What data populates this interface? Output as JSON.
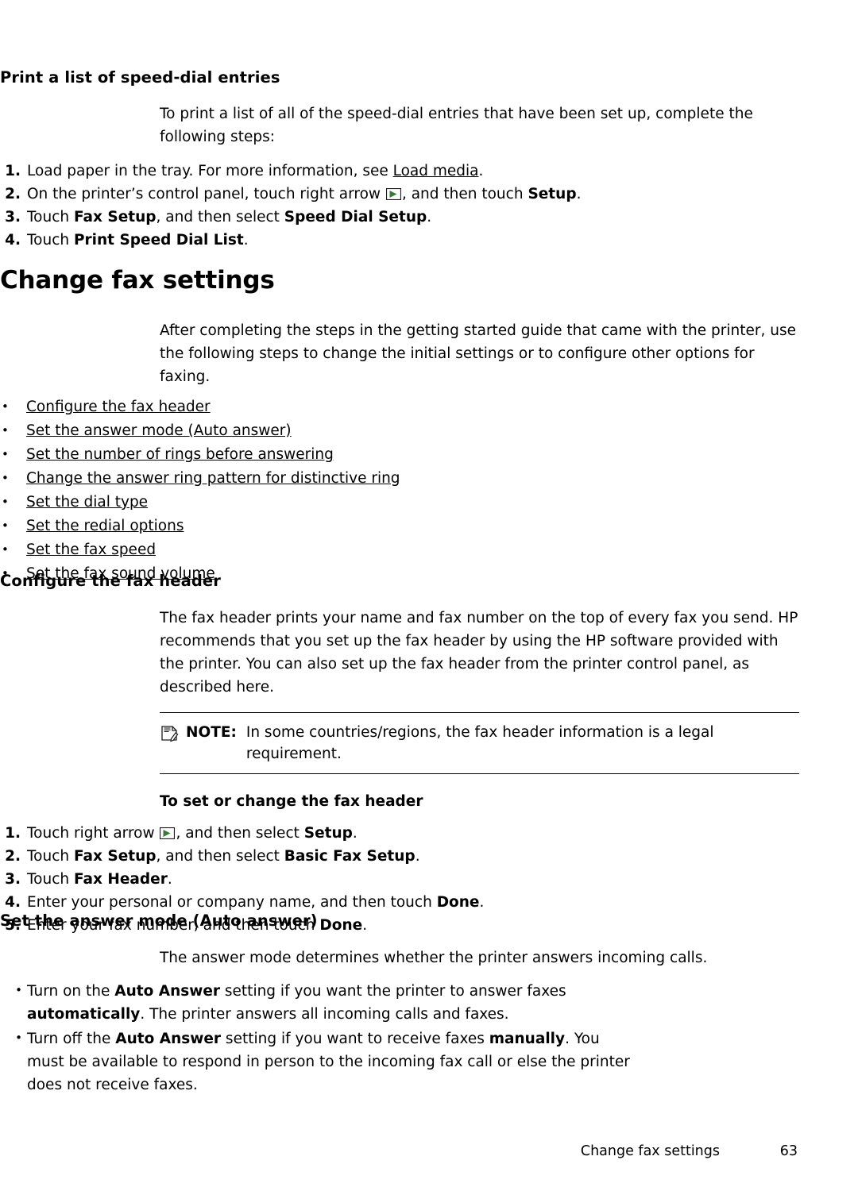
{
  "doc": {
    "section1": {
      "heading": "Print a list of speed-dial entries",
      "intro": "To print a list of all of the speed-dial entries that have been set up, complete the following steps:",
      "steps": [
        {
          "num": "1.",
          "pre": "Load paper in the tray. For more information, see ",
          "link": "Load media",
          "post": "."
        },
        {
          "num": "2.",
          "pre": "On the printer’s control panel, touch right arrow ",
          "icon": "right-arrow-icon",
          "mid": ", and then touch ",
          "bold": "Setup",
          "post": "."
        },
        {
          "num": "3.",
          "pre": "Touch ",
          "bold": "Fax Setup",
          "mid": ", and then select ",
          "bold2": "Speed Dial Setup",
          "post": "."
        },
        {
          "num": "4.",
          "pre": "Touch ",
          "bold": "Print Speed Dial List",
          "post": "."
        }
      ]
    },
    "section2": {
      "heading": "Change fax settings",
      "intro": "After completing the steps in the getting started guide that came with the printer, use the following steps to change the initial settings or to configure other options for faxing.",
      "links": [
        "Configure the fax header",
        "Set the answer mode (Auto answer)",
        "Set the number of rings before answering",
        "Change the answer ring pattern for distinctive ring",
        "Set the dial type",
        "Set the redial options",
        "Set the fax speed",
        "Set the fax sound volume"
      ]
    },
    "section3": {
      "heading": "Configure the fax header",
      "paragraph": "The fax header prints your name and fax number on the top of every fax you send. HP recommends that you set up the fax header by using the HP software provided with the printer. You can also set up the fax header from the printer control panel, as described here.",
      "note": {
        "label": "NOTE:",
        "text": "In some countries/regions, the fax header information is a legal requirement.",
        "icon": "note-icon"
      },
      "procedure_title": "To set or change the fax header",
      "steps": [
        {
          "num": "1.",
          "pre": "Touch right arrow ",
          "icon": "right-arrow-icon",
          "mid": ", and then select ",
          "bold": "Setup",
          "post": "."
        },
        {
          "num": "2.",
          "pre": "Touch ",
          "bold": "Fax Setup",
          "mid": ", and then select ",
          "bold2": "Basic Fax Setup",
          "post": "."
        },
        {
          "num": "3.",
          "pre": "Touch ",
          "bold": "Fax Header",
          "post": "."
        },
        {
          "num": "4.",
          "pre": "Enter your personal or company name, and then touch ",
          "bold": "Done",
          "post": "."
        },
        {
          "num": "5.",
          "pre": "Enter your fax number, and then touch ",
          "bold": "Done",
          "post": "."
        }
      ]
    },
    "section4": {
      "heading": "Set the answer mode (Auto answer)",
      "paragraph": "The answer mode determines whether the printer answers incoming calls.",
      "bullets": [
        {
          "p1": "Turn on the ",
          "b1": "Auto Answer",
          "p2": " setting if you want the printer to answer faxes ",
          "b2": "automatically",
          "p3": ". The printer answers all incoming calls and faxes."
        },
        {
          "p1": "Turn off the ",
          "b1": "Auto Answer",
          "p2": " setting if you want to receive faxes ",
          "b2": "manually",
          "p3": ". You must be available to respond in person to the incoming fax call or else the printer does not receive faxes."
        }
      ]
    },
    "footer": {
      "text": "Change fax settings",
      "page": "63"
    }
  }
}
